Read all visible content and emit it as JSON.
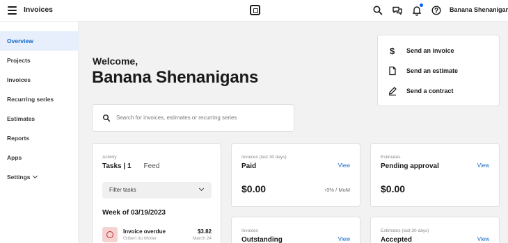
{
  "header": {
    "title": "Invoices",
    "user_name": "Banana Shenanigans",
    "icons": [
      "menu-icon",
      "square-logo-icon",
      "search-icon",
      "chat-icon",
      "bell-icon",
      "help-icon"
    ],
    "notification_dot_color": "#0b5fff"
  },
  "sidebar": {
    "items": [
      {
        "label": "Overview",
        "active": true
      },
      {
        "label": "Projects"
      },
      {
        "label": "Invoices"
      },
      {
        "label": "Recurring series"
      },
      {
        "label": "Estimates"
      },
      {
        "label": "Reports"
      },
      {
        "label": "Apps"
      },
      {
        "label": "Settings"
      }
    ],
    "active_color": "#1467c9"
  },
  "welcome": {
    "greeting": "Welcome,",
    "name": "Banana Shenanigans"
  },
  "search": {
    "placeholder": "Search for invoices, estimates or recurring series"
  },
  "quick_actions": [
    {
      "label": "Send an invoice",
      "icon": "dollar-icon"
    },
    {
      "label": "Send an estimate",
      "icon": "document-icon"
    },
    {
      "label": "Send a contract",
      "icon": "pen-icon"
    }
  ],
  "activity": {
    "small_label": "Activity",
    "tab_tasks": "Tasks | 1",
    "tab_feed": "Feed",
    "filter_label": "Filter tasks",
    "week_label": "Week of 03/19/2023",
    "task": {
      "title": "Invoice overdue",
      "customer": "Gilbert du Motier",
      "amount": "$3.82",
      "date": "March 24"
    }
  },
  "cards": {
    "paid": {
      "small_label": "Invoices (last 30 days)",
      "title": "Paid",
      "view": "View",
      "amount": "$0.00",
      "trend": "↑0% / MoM"
    },
    "pending": {
      "small_label": "Estimates",
      "title": "Pending approval",
      "view": "View",
      "amount": "$0.00"
    },
    "outstanding": {
      "small_label": "Invoices",
      "title": "Outstanding",
      "view": "View"
    },
    "accepted": {
      "small_label": "Estimates (last 30 days)",
      "title": "Accepted",
      "view": "View"
    }
  }
}
